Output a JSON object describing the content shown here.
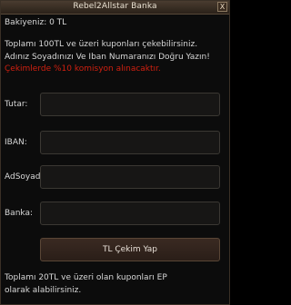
{
  "window": {
    "title": "Rebel2Allstar Banka",
    "close_label": "X"
  },
  "balance": "Bakiyeniz: 0 TL",
  "info": [
    "Toplamı 100TL ve üzeri kuponları çekebilirsiniz.",
    "Adınız Soyadınızı Ve Iban Numaranızı Doğru Yazın!",
    "Çekimlerde %10 komisyon alınacaktır."
  ],
  "form": {
    "fields": [
      {
        "label": "Tutar:",
        "value": ""
      },
      {
        "label": "IBAN:",
        "value": ""
      },
      {
        "label": "AdSoyad",
        "value": ""
      },
      {
        "label": "Banka:",
        "value": ""
      }
    ],
    "submit_label": "TL Çekim Yap"
  },
  "footer": [
    "Toplamı 20TL ve üzeri olan kuponları EP",
    "olarak alabilirsiniz."
  ],
  "colors": {
    "warning": "#d02010",
    "background": "#0c0c0c"
  }
}
